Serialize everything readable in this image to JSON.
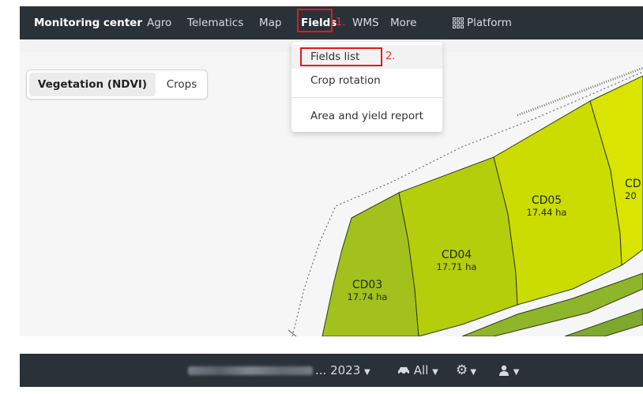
{
  "topnav": {
    "items": [
      {
        "label": "Monitoring center",
        "active": true
      },
      {
        "label": "Agro"
      },
      {
        "label": "Telematics"
      },
      {
        "label": "Map"
      },
      {
        "label": "Fields",
        "highlighted": true
      },
      {
        "label": "WMS"
      },
      {
        "label": "More"
      },
      {
        "label": "Platform",
        "icon": "grid-icon"
      }
    ],
    "step1": "1.",
    "step2": "2."
  },
  "dropdown": {
    "items": [
      {
        "label": "Fields list",
        "highlighted": true
      },
      {
        "label": "Crop rotation"
      },
      {
        "label": "Area and yield report"
      }
    ]
  },
  "layer_toggle": {
    "options": [
      "Vegetation (NDVI)",
      "Crops"
    ],
    "selected": "Vegetation (NDVI)"
  },
  "fields": [
    {
      "name": "CD03",
      "area": "17.74 ha",
      "color": "#a2c11c"
    },
    {
      "name": "CD04",
      "area": "17.71 ha",
      "color": "#b4ce0c"
    },
    {
      "name": "CD05",
      "area": "17.44 ha",
      "color": "#cbdc00"
    },
    {
      "name": "CD",
      "area": "20",
      "color": "#d9e400"
    }
  ],
  "bottombar": {
    "season": "... 2023",
    "vehicles": "All",
    "settings_icon": "gear-icon",
    "user_icon": "user-icon"
  },
  "colors": {
    "navbar": "#2b3139",
    "highlight_box": "#e01b1b"
  }
}
